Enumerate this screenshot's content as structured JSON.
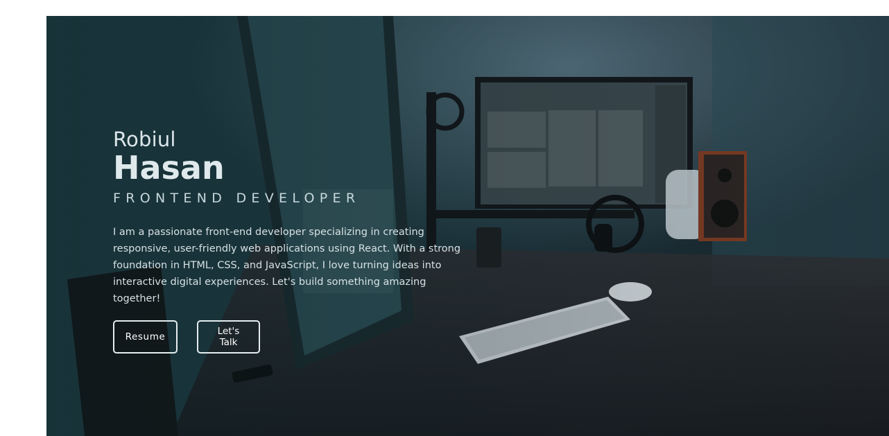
{
  "hero": {
    "first_name": "Robiul",
    "last_name": "Hasan",
    "role": "FRONTEND DEVELOPER",
    "bio": "I am a passionate front-end developer specializing in creating responsive, user-friendly web applications using React. With a strong foundation in HTML, CSS, and JavaScript, I love turning ideas into interactive digital experiences. Let's build something amazing together!",
    "buttons": {
      "resume_label": "Resume",
      "talk_label": "Let's Talk"
    },
    "background_image": "desk-setup-photo"
  },
  "colors": {
    "overlay": "#1d3940",
    "text": "#e6eef0",
    "button_border": "#e6eef0"
  }
}
